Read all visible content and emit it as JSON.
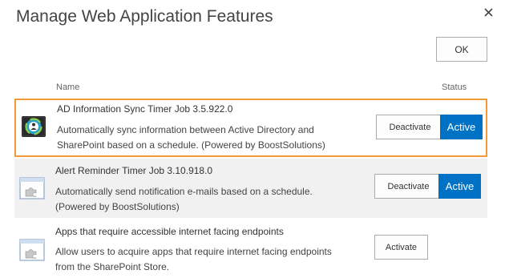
{
  "dialog": {
    "title": "Manage Web Application Features",
    "ok_label": "OK",
    "close_icon": "close-icon"
  },
  "columns": {
    "name": "Name",
    "status": "Status"
  },
  "features": [
    {
      "title": "AD Information Sync Timer Job 3.5.922.0",
      "description": "Automatically sync information between Active Directory and SharePoint based on a schedule. (Powered by BoostSolutions)",
      "action_label": "Deactivate",
      "status": "Active",
      "icon": "ad-sync-icon",
      "highlighted": true
    },
    {
      "title": "Alert Reminder Timer Job 3.10.918.0",
      "description": "Automatically send notification e-mails based on a schedule. (Powered by BoostSolutions)",
      "action_label": "Deactivate",
      "status": "Active",
      "icon": "feature-puzzle-icon"
    },
    {
      "title": "Apps that require accessible internet facing endpoints",
      "description": "Allow users to acquire apps that require internet facing endpoints from the SharePoint Store.",
      "action_label": "Activate",
      "status": "",
      "icon": "feature-puzzle-icon"
    }
  ],
  "colors": {
    "highlight_border": "#f29a38",
    "active_badge": "#0072c6",
    "alt_row_bg": "#f1f1f1"
  }
}
